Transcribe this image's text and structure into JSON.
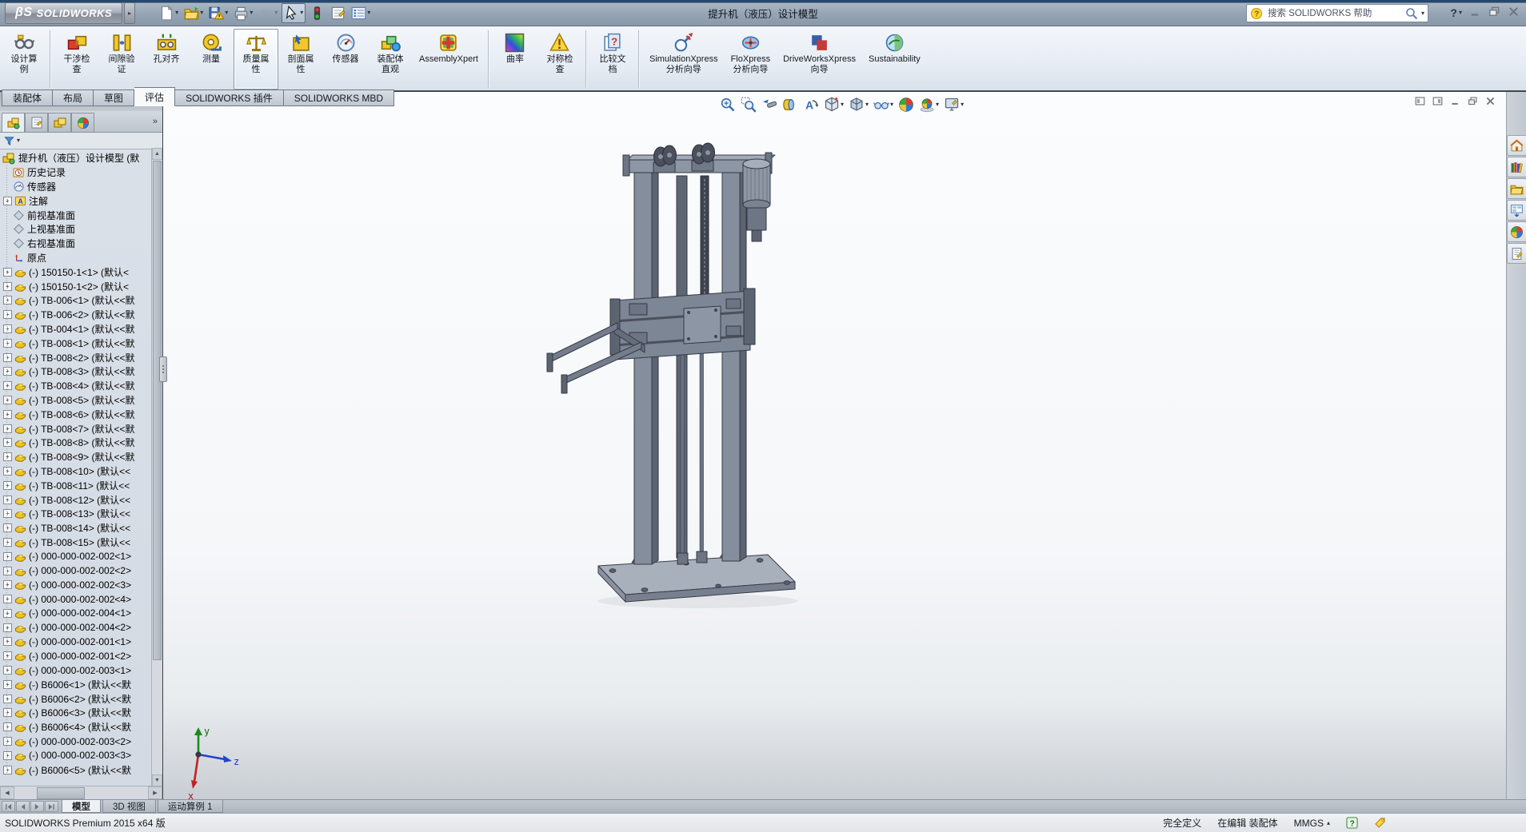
{
  "titlebar": {
    "brand_prefix": "βS",
    "brand": "SOLIDWORKS",
    "title": "提升机（液压）设计模型",
    "search_placeholder": "搜索 SOLIDWORKS 帮助"
  },
  "quick_toolbar": [
    {
      "icon": "new-doc",
      "dropdown": true
    },
    {
      "icon": "open-folder",
      "dropdown": true
    },
    {
      "icon": "save",
      "dropdown": true
    },
    {
      "icon": "print",
      "dropdown": true
    },
    {
      "icon": "undo",
      "dropdown": true,
      "disabled": true
    },
    {
      "icon": "select-cursor",
      "dropdown": true,
      "pressed": true
    },
    {
      "icon": "rebuild-traffic-light",
      "dropdown": false
    },
    {
      "icon": "file-properties",
      "dropdown": false
    },
    {
      "icon": "options-list",
      "dropdown": true
    }
  ],
  "ribbon": {
    "buttons": [
      {
        "label": "设计算\n例",
        "icon": "design-study"
      },
      {
        "sep": true
      },
      {
        "label": "干涉检\n查",
        "icon": "interference-check"
      },
      {
        "label": "间隙验\n证",
        "icon": "clearance-verify"
      },
      {
        "label": "孔对齐",
        "icon": "hole-alignment"
      },
      {
        "label": "测量",
        "icon": "measure"
      },
      {
        "label": "质量属\n性",
        "icon": "mass-properties",
        "selected": true
      },
      {
        "label": "剖面属\n性",
        "icon": "section-properties"
      },
      {
        "label": "传感器",
        "icon": "sensor"
      },
      {
        "label": "装配体\n直观",
        "icon": "assembly-visualization"
      },
      {
        "label": "AssemblyXpert",
        "icon": "assemblyxpert"
      },
      {
        "sep": true
      },
      {
        "label": "曲率",
        "icon": "curvature"
      },
      {
        "label": "对称检\n查",
        "icon": "symmetry-check"
      },
      {
        "sep": true
      },
      {
        "label": "比较文\n档",
        "icon": "compare-documents"
      },
      {
        "sep": true
      },
      {
        "label": "SimulationXpress\n分析向导",
        "icon": "simulationxpress"
      },
      {
        "label": "FloXpress\n分析向导",
        "icon": "floxpress"
      },
      {
        "label": "DriveWorksXpress\n向导",
        "icon": "driveworksxpress"
      },
      {
        "label": "Sustainability",
        "icon": "sustainability"
      }
    ]
  },
  "command_tabs": [
    {
      "label": "装配体"
    },
    {
      "label": "布局"
    },
    {
      "label": "草图"
    },
    {
      "label": "评估",
      "active": true
    },
    {
      "label": "SOLIDWORKS 插件"
    },
    {
      "label": "SOLIDWORKS MBD"
    }
  ],
  "feature_manager": {
    "tabs": [
      "featuremanager",
      "propertymanager",
      "configurationmanager",
      "displaymanager"
    ],
    "chevron": "»",
    "root": "提升机（液压）设计模型 (默",
    "items": [
      {
        "label": "历史记录",
        "icon": "history"
      },
      {
        "label": "传感器",
        "icon": "sensors"
      },
      {
        "label": "注解",
        "icon": "annotations",
        "expandable": true
      },
      {
        "label": "前视基准面",
        "icon": "plane"
      },
      {
        "label": "上视基准面",
        "icon": "plane"
      },
      {
        "label": "右视基准面",
        "icon": "plane"
      },
      {
        "label": "原点",
        "icon": "origin"
      },
      {
        "label": "(-) 150150-1<1> (默认<",
        "icon": "part",
        "expandable": true
      },
      {
        "label": "(-) 150150-1<2> (默认<",
        "icon": "part",
        "expandable": true
      },
      {
        "label": "(-) TB-006<1> (默认<<默",
        "icon": "part",
        "expandable": true
      },
      {
        "label": "(-) TB-006<2> (默认<<默",
        "icon": "part",
        "expandable": true
      },
      {
        "label": "(-) TB-004<1> (默认<<默",
        "icon": "part",
        "expandable": true
      },
      {
        "label": "(-) TB-008<1> (默认<<默",
        "icon": "part",
        "expandable": true
      },
      {
        "label": "(-) TB-008<2> (默认<<默",
        "icon": "part",
        "expandable": true
      },
      {
        "label": "(-) TB-008<3> (默认<<默",
        "icon": "part",
        "expandable": true
      },
      {
        "label": "(-) TB-008<4> (默认<<默",
        "icon": "part",
        "expandable": true
      },
      {
        "label": "(-) TB-008<5> (默认<<默",
        "icon": "part",
        "expandable": true
      },
      {
        "label": "(-) TB-008<6> (默认<<默",
        "icon": "part",
        "expandable": true
      },
      {
        "label": "(-) TB-008<7> (默认<<默",
        "icon": "part",
        "expandable": true
      },
      {
        "label": "(-) TB-008<8> (默认<<默",
        "icon": "part",
        "expandable": true
      },
      {
        "label": "(-) TB-008<9> (默认<<默",
        "icon": "part",
        "expandable": true
      },
      {
        "label": "(-) TB-008<10> (默认<<",
        "icon": "part",
        "expandable": true
      },
      {
        "label": "(-) TB-008<11> (默认<<",
        "icon": "part",
        "expandable": true
      },
      {
        "label": "(-) TB-008<12> (默认<<",
        "icon": "part",
        "expandable": true
      },
      {
        "label": "(-) TB-008<13> (默认<<",
        "icon": "part",
        "expandable": true
      },
      {
        "label": "(-) TB-008<14> (默认<<",
        "icon": "part",
        "expandable": true
      },
      {
        "label": "(-) TB-008<15> (默认<<",
        "icon": "part",
        "expandable": true
      },
      {
        "label": "(-) 000-000-002-002<1>",
        "icon": "part",
        "expandable": true
      },
      {
        "label": "(-) 000-000-002-002<2>",
        "icon": "part",
        "expandable": true
      },
      {
        "label": "(-) 000-000-002-002<3>",
        "icon": "part",
        "expandable": true
      },
      {
        "label": "(-) 000-000-002-002<4>",
        "icon": "part",
        "expandable": true
      },
      {
        "label": "(-) 000-000-002-004<1>",
        "icon": "part",
        "expandable": true
      },
      {
        "label": "(-) 000-000-002-004<2>",
        "icon": "part",
        "expandable": true
      },
      {
        "label": "(-) 000-000-002-001<1>",
        "icon": "part",
        "expandable": true
      },
      {
        "label": "(-) 000-000-002-001<2>",
        "icon": "part",
        "expandable": true
      },
      {
        "label": "(-) 000-000-002-003<1>",
        "icon": "part",
        "expandable": true
      },
      {
        "label": "(-) B6006<1> (默认<<默",
        "icon": "part",
        "expandable": true
      },
      {
        "label": "(-) B6006<2> (默认<<默",
        "icon": "part",
        "expandable": true
      },
      {
        "label": "(-) B6006<3> (默认<<默",
        "icon": "part",
        "expandable": true
      },
      {
        "label": "(-) B6006<4> (默认<<默",
        "icon": "part",
        "expandable": true
      },
      {
        "label": "(-) 000-000-002-003<2>",
        "icon": "part",
        "expandable": true
      },
      {
        "label": "(-) 000-000-002-003<3>",
        "icon": "part",
        "expandable": true
      },
      {
        "label": "(-) B6006<5> (默认<<默",
        "icon": "part",
        "expandable": true
      }
    ]
  },
  "headsup_toolbar": [
    {
      "icon": "zoom-fit"
    },
    {
      "icon": "zoom-area"
    },
    {
      "icon": "previous-view"
    },
    {
      "icon": "section-view"
    },
    {
      "icon": "annotation-views"
    },
    {
      "icon": "view-orientation",
      "dropdown": true
    },
    {
      "icon": "display-style",
      "dropdown": true
    },
    {
      "icon": "hide-show-items",
      "dropdown": true
    },
    {
      "icon": "edit-appearance"
    },
    {
      "icon": "apply-scene",
      "dropdown": true
    },
    {
      "icon": "view-settings",
      "dropdown": true
    }
  ],
  "document_window_controls": [
    "window-tile-left",
    "window-tile-right",
    "window-minimize",
    "window-restore",
    "window-close"
  ],
  "task_pane": [
    "solidworks-resources",
    "design-library",
    "file-explorer",
    "view-palette",
    "appearances",
    "custom-properties"
  ],
  "triad": {
    "axis_up": "y",
    "axis_right": "z",
    "axis_down": "x"
  },
  "bottom_bar": {
    "nav": [
      "nav-first",
      "nav-prev",
      "nav-next",
      "nav-last"
    ],
    "tabs": [
      {
        "label": "模型",
        "active": true
      },
      {
        "label": "3D 视图"
      },
      {
        "label": "运动算例 1"
      }
    ]
  },
  "status_bar": {
    "left": "SOLIDWORKS Premium 2015 x64 版",
    "items": [
      {
        "label": "完全定义"
      },
      {
        "label": "在编辑 装配体"
      },
      {
        "label": "MMGS",
        "dropdown": true
      },
      {
        "icon": "status-help"
      },
      {
        "icon": "status-tag"
      }
    ]
  }
}
